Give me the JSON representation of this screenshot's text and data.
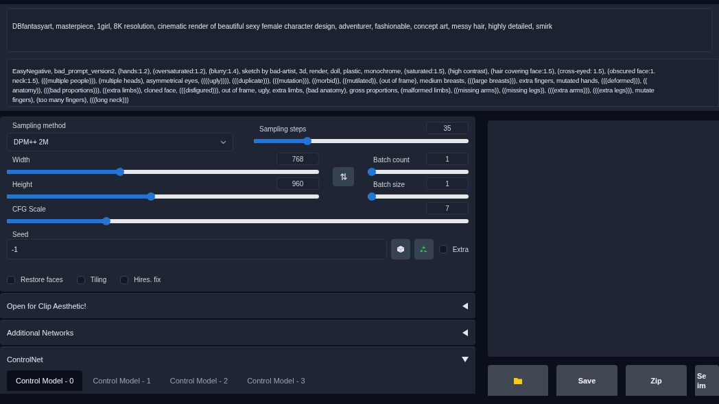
{
  "prompt": {
    "text": "DBfantasyart, masterpiece, 1girl, 8K resolution, cinematic render of beautiful sexy female character design, adventurer, fashionable, concept art, messy hair, highly detailed, smirk"
  },
  "negative_prompt": {
    "lines": [
      "EasyNegative, bad_prompt_version2, (hands:1.2), (oversaturated:1.2), (blurry:1.4), sketch by bad-artist, 3d, render, doll, plastic, monochrome, (saturated:1.5), (high contrast), (hair covering face:1.5), (cross-eyed: 1.5), (obscured face:1.",
      "neck:1.5), (((multiple people))), (multiple heads), asymmetrical eyes, ((((ugly)))), (((duplicate))), (((mutation))), ((morbid)), ((mutilated)), (out of frame), medium breasts, (((large breasts))), extra fingers, mutated hands, (((deformed))), ((",
      "anatomy)), (((bad proportions))), ((extra limbs)), cloned face, (((disfigured))), out of frame, ugly, extra limbs, (bad anatomy), gross proportions, (malformed limbs), ((missing arms)), ((missing legs)), (((extra arms))), (((extra legs))), mutate",
      "fingers), (too many fingers), (((long neck)))"
    ]
  },
  "sampling_method": {
    "label": "Sampling method",
    "value": "DPM++ 2M"
  },
  "sliders": [
    {
      "label": "Sampling steps",
      "value": "35",
      "level": 0.24
    },
    {
      "label": "Width",
      "value": "768",
      "level": 0.36
    },
    {
      "label": "Batch count",
      "value": "1",
      "level": 0
    },
    {
      "label": "Height",
      "value": "960",
      "level": 0.46
    },
    {
      "label": "Batch size",
      "value": "1",
      "level": 0
    },
    {
      "label": "CFG Scale",
      "value": "7",
      "level": 0.21
    }
  ],
  "seed": {
    "label": "Seed",
    "value": "-1",
    "extra": {
      "label": "Extra",
      "checked": false
    }
  },
  "options": [
    {
      "label": "Restore faces",
      "checked": false
    },
    {
      "label": "Tiling",
      "checked": false
    },
    {
      "label": "Hires. fix",
      "checked": false
    }
  ],
  "accordions": [
    {
      "title": "Open for Clip Aesthetic!",
      "expanded": false
    },
    {
      "title": "Additional Networks",
      "expanded": false
    },
    {
      "title": "ControlNet",
      "expanded": true
    }
  ],
  "controlnet_tabs": [
    {
      "label": "Control Model - 0",
      "selected": true
    },
    {
      "label": "Control Model - 1",
      "selected": false
    },
    {
      "label": "Control Model - 2",
      "selected": false
    },
    {
      "label": "Control Model - 3",
      "selected": false
    }
  ],
  "output_buttons": [
    {
      "kind": "folder"
    },
    {
      "kind": "text",
      "label": "Save"
    },
    {
      "kind": "text",
      "label": "Zip"
    },
    {
      "kind": "text",
      "label": "Se",
      "label2": "im"
    }
  ]
}
